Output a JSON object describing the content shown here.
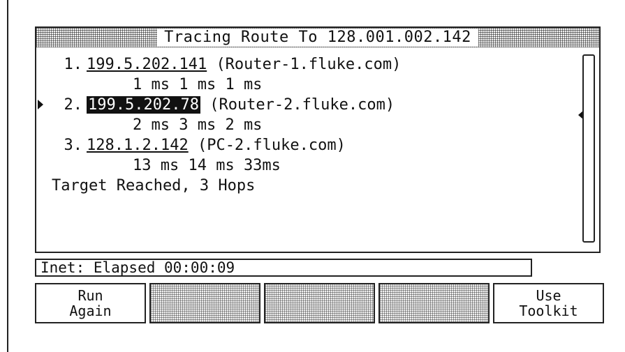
{
  "title": "Tracing Route To 128.001.002.142",
  "hops": [
    {
      "index": "1.",
      "ip": "199.5.202.141",
      "host": "(Router-1.fluke.com)",
      "times": "1 ms 1 ms 1 ms",
      "selected": false
    },
    {
      "index": "2.",
      "ip": "199.5.202.78",
      "host": "(Router-2.fluke.com)",
      "times": "2 ms 3 ms 2 ms",
      "selected": true
    },
    {
      "index": "3.",
      "ip": "128.1.2.142",
      "host": "(PC-2.fluke.com)",
      "times": "13 ms 14 ms 33ms",
      "selected": false
    }
  ],
  "summary": "Target Reached, 3 Hops",
  "status": "Inet: Elapsed 00:00:09",
  "softkeys": {
    "run_again_line1": "Run",
    "run_again_line2": "Again",
    "use_toolkit_line1": "Use",
    "use_toolkit_line2": "Toolkit"
  }
}
